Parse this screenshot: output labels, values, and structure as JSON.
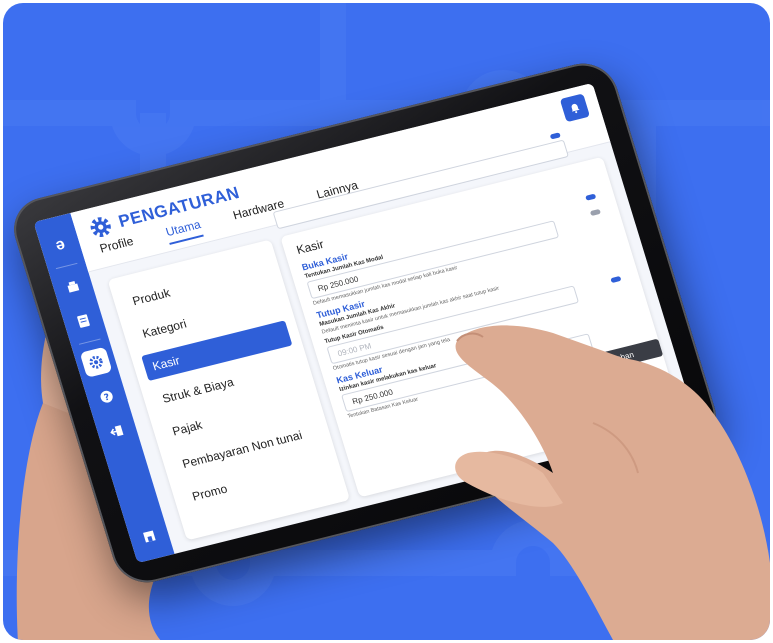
{
  "app": {
    "page_title": "PENGATURAN",
    "tabs": [
      {
        "label": "Profile"
      },
      {
        "label": "Utama"
      },
      {
        "label": "Hardware"
      },
      {
        "label": "Lainnya"
      }
    ]
  },
  "sidebar": {
    "logo_glyph": "ǝ",
    "icons": [
      "logo-icon",
      "cash-register-icon",
      "document-icon",
      "gear-icon",
      "help-icon",
      "exit-icon",
      "store-icon"
    ]
  },
  "menu": {
    "items": [
      {
        "label": "Produk"
      },
      {
        "label": "Kategori"
      },
      {
        "label": "Kasir"
      },
      {
        "label": "Struk & Biaya"
      },
      {
        "label": "Pajak"
      },
      {
        "label": "Pembayaran Non tunai"
      },
      {
        "label": "Promo"
      }
    ]
  },
  "kasir": {
    "title": "Kasir",
    "buka_kasir": {
      "section": "Buka Kasir",
      "field_label": "Tentukan Jumlah Kas Modal",
      "value": "Rp 250.000",
      "hint": "Default memasukkan jumlah kas modal setiap kali buka kasir"
    },
    "tutup_kasir": {
      "section": "Tutup Kasir",
      "field_label": "Masukan Jumlah Kas Akhir",
      "hint": "Default meminta kasir untuk memasukkan jumlah kas akhir saat tutup kasir",
      "auto_label": "Tutup Kasir Otomatis",
      "auto_placeholder": "09:00 PM",
      "auto_hint": "Otomatis tutup kasir sesuai dengan jam yang tela"
    },
    "kas_keluar": {
      "section": "Kas Keluar",
      "field_label": "Izinkan kasir melakukan kas keluar",
      "value": "Rp 250.000",
      "hint": "Tentukan Batasan Kas Keluar"
    },
    "save_label": "bahan"
  },
  "colors": {
    "background": "#3d6ff0",
    "primary": "#2f5fd8",
    "tablet_frame": "#111114"
  }
}
